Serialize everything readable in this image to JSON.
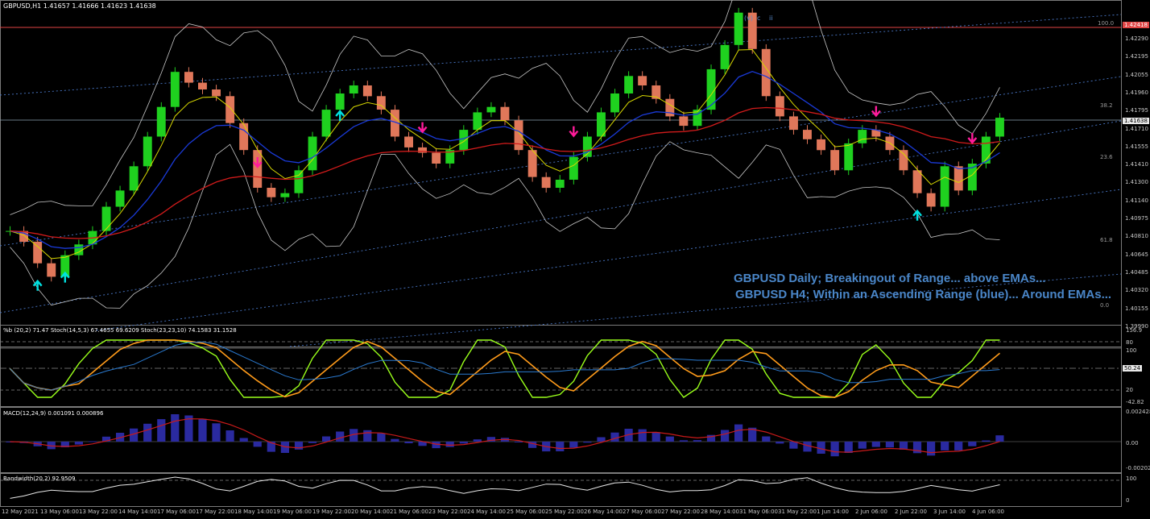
{
  "chart_data": {
    "type": "line",
    "symbol": "GBPUSD,H1",
    "title": "GBPUSD,H1 1.41657 1.41666 1.41623 1.41638",
    "ohlc": {
      "open": 1.41657,
      "high": 1.41666,
      "low": 1.41623,
      "close": 1.41638
    },
    "wave_labels": [
      "(v)",
      "c",
      "ii"
    ],
    "annotations": [
      "GBPUSD Daily; Breakingout of Range... above EMAs...",
      "GBPUSD H4; Within an Ascending Range (blue)... Around EMAs..."
    ],
    "price_axis": {
      "ticks": [
        "1.42290",
        "1.42195",
        "1.42055",
        "1.41960",
        "1.41795",
        "1.41710",
        "1.41555",
        "1.41410",
        "1.41300",
        "1.41140",
        "1.40975",
        "1.40810",
        "1.40645",
        "1.40485",
        "1.40320",
        "1.40155",
        "1.39990"
      ],
      "current_price": "1.41638",
      "level_price": "1.42418",
      "fib_levels": [
        "100.0",
        "38.2",
        "23.6",
        "61.8",
        "0.0"
      ],
      "ylim": [
        1.3999,
        1.4243
      ]
    },
    "x_axis": {
      "ticks": [
        "12 May 2021",
        "13 May 06:00",
        "13 May 22:00",
        "14 May 14:00",
        "17 May 06:00",
        "17 May 22:00",
        "18 May 14:00",
        "19 May 06:00",
        "19 May 22:00",
        "20 May 14:00",
        "21 May 06:00",
        "23 May 22:00",
        "24 May 14:00",
        "25 May 06:00",
        "25 May 22:00",
        "26 May 14:00",
        "27 May 06:00",
        "27 May 22:00",
        "28 May 14:00",
        "31 May 06:00",
        "31 May 22:00",
        "1 Jun 14:00",
        "2 Jun 06:00",
        "2 Jun 22:00",
        "3 Jun 14:00",
        "4 Jun 06:00"
      ]
    },
    "series": [
      {
        "name": "GBPUSD,H1",
        "values": [
          1.408,
          1.4072,
          1.4056,
          1.4046,
          1.4062,
          1.407,
          1.408,
          1.4098,
          1.411,
          1.4128,
          1.415,
          1.4172,
          1.4198,
          1.419,
          1.4185,
          1.418,
          1.416,
          1.414,
          1.4112,
          1.4105,
          1.4108,
          1.4125,
          1.415,
          1.417,
          1.4182,
          1.4188,
          1.418,
          1.417,
          1.415,
          1.4142,
          1.4138,
          1.413,
          1.414,
          1.4155,
          1.4168,
          1.4172,
          1.4162,
          1.414,
          1.412,
          1.4112,
          1.4118,
          1.4135,
          1.415,
          1.4168,
          1.4182,
          1.4195,
          1.4188,
          1.4178,
          1.4165,
          1.4158,
          1.417,
          1.42,
          1.4218,
          1.4242,
          1.4215,
          1.418,
          1.4165,
          1.4155,
          1.4148,
          1.414,
          1.4125,
          1.4145,
          1.4155,
          1.415,
          1.414,
          1.4125,
          1.4108,
          1.4098,
          1.4128,
          1.411,
          1.413,
          1.415,
          1.4164
        ]
      },
      {
        "name": "%b (20,2)",
        "values": [
          71.47
        ]
      },
      {
        "name": "Stoch(14,5,3)",
        "values": [
          67.4655,
          69.6209
        ]
      },
      {
        "name": "Stoch(23,23,10)",
        "values": [
          74.1583,
          31.1528
        ]
      },
      {
        "name": "MACD(12,24,9)",
        "values": [
          0.001091,
          0.000896
        ]
      },
      {
        "name": "Bandwidth(20,2)",
        "values": [
          92.9509
        ]
      }
    ],
    "oscillator_panel": {
      "header": "%b (20,2) 71.47   Stoch(14,5,3) 67.4655 69.6209   Stoch(23,23,10) 74.1583 31.1528",
      "axis": [
        "156.9",
        "80",
        "100",
        "50.24",
        "20",
        "-42.82"
      ]
    },
    "macd_panel": {
      "header": "MACD(12,24,9) 0.001091 0.000896",
      "axis": [
        "0.002428",
        "0.00",
        "-0.00202"
      ]
    },
    "bandwidth_panel": {
      "header": "Bandwidth(20,2) 92.9509",
      "axis": [
        "100",
        "0"
      ]
    },
    "colors": {
      "background": "#000000",
      "bull": "#1fd11f",
      "bear": "#e0775a",
      "ema_fast": "#d8d800",
      "ema_mid": "#1a3ad8",
      "ema_slow": "#d21b1b",
      "bollinger": "#c8c8c8",
      "channel": "#4a78c8",
      "arrow_down": "#ff1b9a",
      "arrow_up": "#00e0e0",
      "stoch_fast": "#9aff1a",
      "stoch_slow": "#ff9b1a",
      "macd_hist": "#2a2aa0",
      "macd_signal": "#c81a1a",
      "annotation": "#4a86c8",
      "price_tag": "#e8e8e8",
      "level_tag": "#e04545"
    },
    "arrow_signals": {
      "down_at_index": [
        18,
        30,
        41,
        53,
        63,
        70,
        78
      ],
      "up_at_index": [
        2,
        4,
        24,
        66
      ]
    },
    "grid": false
  }
}
